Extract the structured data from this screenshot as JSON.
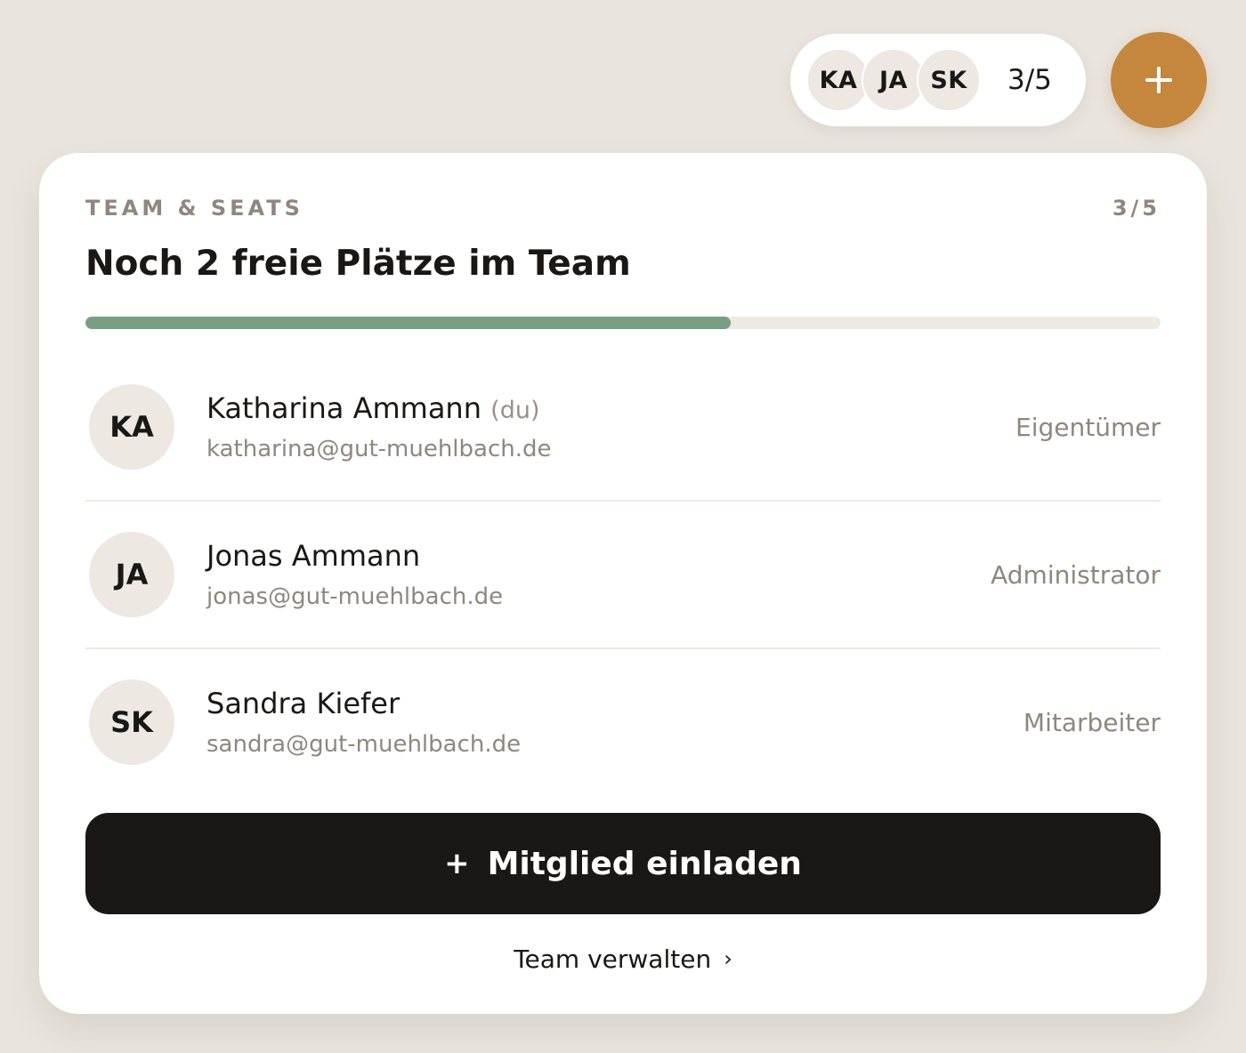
{
  "seat_pill": {
    "avatars": [
      "KA",
      "JA",
      "SK"
    ],
    "count": "3/5"
  },
  "fab": {
    "icon": "plus-icon"
  },
  "card": {
    "eyebrow": "TEAM & SEATS",
    "eyebrow_count": "3/5",
    "title": "Noch 2 freie Plätze im Team",
    "progress": {
      "used": 3,
      "total": 5,
      "fraction": 0.6,
      "fill_color": "#7a9e83",
      "track_color": "#eee9e2"
    },
    "members": [
      {
        "initials": "KA",
        "name": "Katharina Ammann",
        "you_tag": "(du)",
        "email": "katharina@gut-muehlbach.de",
        "role": "Eigentümer"
      },
      {
        "initials": "JA",
        "name": "Jonas Ammann",
        "you_tag": "",
        "email": "jonas@gut-muehlbach.de",
        "role": "Administrator"
      },
      {
        "initials": "SK",
        "name": "Sandra Kiefer",
        "you_tag": "",
        "email": "sandra@gut-muehlbach.de",
        "role": "Mitarbeiter"
      }
    ],
    "invite_button": {
      "icon": "+",
      "label": "Mitglied einladen"
    },
    "manage_link": {
      "label": "Team verwalten",
      "chevron": "›"
    }
  },
  "colors": {
    "background": "#e9e4dd",
    "accent": "#c4873d",
    "primary_button": "#1a1816"
  }
}
